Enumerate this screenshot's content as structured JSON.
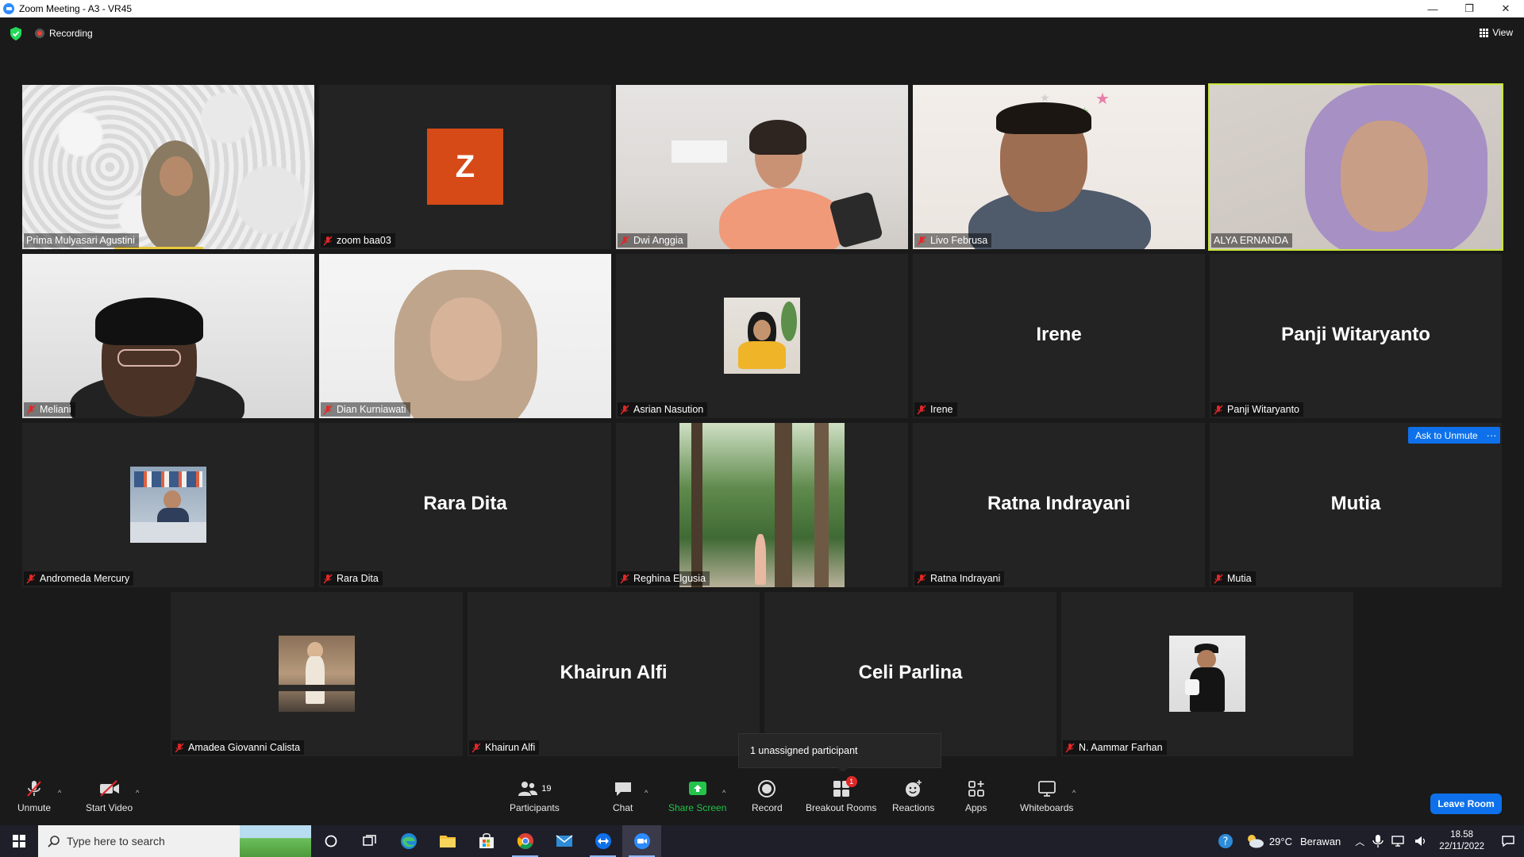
{
  "window": {
    "title": "Zoom Meeting - A3 - VR45",
    "minimize_glyph": "—",
    "restore_glyph": "❐",
    "close_glyph": "✕"
  },
  "topbar": {
    "recording_label": "Recording",
    "view_label": "View"
  },
  "participants": [
    {
      "name": "Prima Mulyasari Agustini",
      "type": "video",
      "muted": false,
      "speaking": true
    },
    {
      "name": "zoom baa03",
      "type": "avatar-letter",
      "letter": "Z",
      "muted": true
    },
    {
      "name": "Dwi Anggia",
      "type": "video",
      "muted": true
    },
    {
      "name": "Livo Februsa",
      "type": "video",
      "muted": true
    },
    {
      "name": "ALYA ERNANDA",
      "type": "video",
      "muted": false,
      "active": true
    },
    {
      "name": "Meliani",
      "type": "video",
      "muted": true
    },
    {
      "name": "Dian Kurniawati",
      "type": "video",
      "muted": true
    },
    {
      "name": "Asrian Nasution",
      "type": "photo",
      "muted": true
    },
    {
      "name": "Irene",
      "type": "name-only",
      "display_name": "Irene",
      "muted": true
    },
    {
      "name": "Panji Witaryanto",
      "type": "name-only",
      "display_name": "Panji Witaryanto",
      "muted": true
    },
    {
      "name": "Andromeda Mercury",
      "type": "photo",
      "muted": true
    },
    {
      "name": "Rara Dita",
      "type": "name-only",
      "display_name": "Rara Dita",
      "muted": true
    },
    {
      "name": "Reghina Elgusia",
      "type": "video",
      "muted": true
    },
    {
      "name": "Ratna Indrayani",
      "type": "name-only",
      "display_name": "Ratna Indrayani",
      "muted": true
    },
    {
      "name": "Mutia",
      "type": "name-only",
      "display_name": "Mutia",
      "muted": true
    },
    {
      "name": "Amadea Giovanni Calista",
      "type": "photo",
      "muted": true
    },
    {
      "name": "Khairun Alfi",
      "type": "name-only",
      "display_name": "Khairun Alfi",
      "muted": true
    },
    {
      "name": "Celi Parlina",
      "type": "name-only",
      "display_name": "Celi Parlina",
      "muted": true
    },
    {
      "name": "N. Aammar Farhan",
      "type": "photo",
      "muted": true
    }
  ],
  "hover_controls": {
    "ask_to_unmute": "Ask to Unmute",
    "more": "···"
  },
  "popup": {
    "unassigned": "1 unassigned participant"
  },
  "toolbar": {
    "unmute": "Unmute",
    "start_video": "Start Video",
    "participants": "Participants",
    "participants_count": "19",
    "chat": "Chat",
    "share_screen": "Share Screen",
    "record": "Record",
    "breakout_rooms": "Breakout Rooms",
    "breakout_badge": "1",
    "reactions": "Reactions",
    "apps": "Apps",
    "whiteboards": "Whiteboards",
    "leave_room": "Leave Room",
    "caret": "^"
  },
  "taskbar": {
    "search_placeholder": "Type here to search",
    "weather_temp": "29°C",
    "weather_desc": "Berawan",
    "time": "18.58",
    "date": "22/11/2022"
  },
  "colors": {
    "accent_blue": "#0e71eb",
    "active_speaker": "#c8e63c",
    "share_green": "#24c34b",
    "muted_red": "#e02828"
  }
}
